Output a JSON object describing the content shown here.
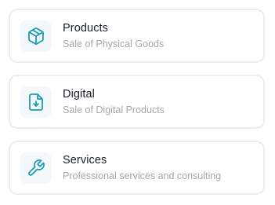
{
  "accent_color": "#1a9db3",
  "options": [
    {
      "icon": "package-box-icon",
      "title": "Products",
      "subtitle": "Sale of Physical Goods"
    },
    {
      "icon": "file-download-icon",
      "title": "Digital",
      "subtitle": "Sale of Digital Products"
    },
    {
      "icon": "wrench-icon",
      "title": "Services",
      "subtitle": "Professional services and consulting"
    }
  ]
}
